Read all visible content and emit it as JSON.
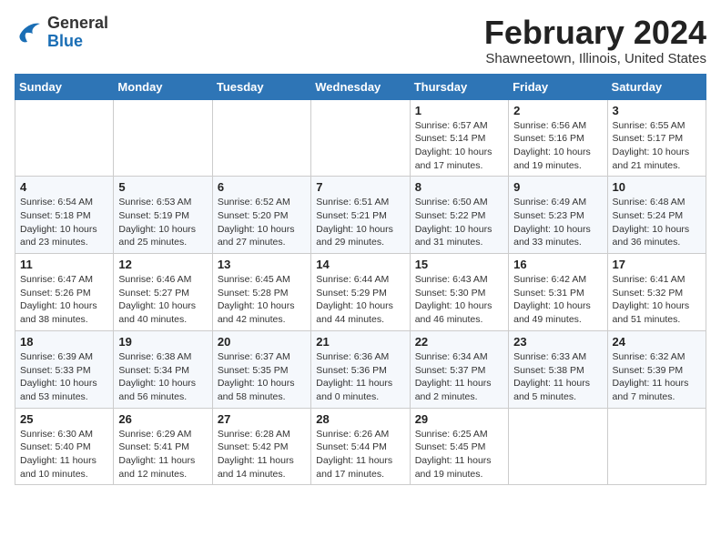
{
  "header": {
    "logo_general": "General",
    "logo_blue": "Blue",
    "month_year": "February 2024",
    "location": "Shawneetown, Illinois, United States"
  },
  "days_of_week": [
    "Sunday",
    "Monday",
    "Tuesday",
    "Wednesday",
    "Thursday",
    "Friday",
    "Saturday"
  ],
  "weeks": [
    [
      {
        "day": "",
        "info": ""
      },
      {
        "day": "",
        "info": ""
      },
      {
        "day": "",
        "info": ""
      },
      {
        "day": "",
        "info": ""
      },
      {
        "day": "1",
        "info": "Sunrise: 6:57 AM\nSunset: 5:14 PM\nDaylight: 10 hours\nand 17 minutes."
      },
      {
        "day": "2",
        "info": "Sunrise: 6:56 AM\nSunset: 5:16 PM\nDaylight: 10 hours\nand 19 minutes."
      },
      {
        "day": "3",
        "info": "Sunrise: 6:55 AM\nSunset: 5:17 PM\nDaylight: 10 hours\nand 21 minutes."
      }
    ],
    [
      {
        "day": "4",
        "info": "Sunrise: 6:54 AM\nSunset: 5:18 PM\nDaylight: 10 hours\nand 23 minutes."
      },
      {
        "day": "5",
        "info": "Sunrise: 6:53 AM\nSunset: 5:19 PM\nDaylight: 10 hours\nand 25 minutes."
      },
      {
        "day": "6",
        "info": "Sunrise: 6:52 AM\nSunset: 5:20 PM\nDaylight: 10 hours\nand 27 minutes."
      },
      {
        "day": "7",
        "info": "Sunrise: 6:51 AM\nSunset: 5:21 PM\nDaylight: 10 hours\nand 29 minutes."
      },
      {
        "day": "8",
        "info": "Sunrise: 6:50 AM\nSunset: 5:22 PM\nDaylight: 10 hours\nand 31 minutes."
      },
      {
        "day": "9",
        "info": "Sunrise: 6:49 AM\nSunset: 5:23 PM\nDaylight: 10 hours\nand 33 minutes."
      },
      {
        "day": "10",
        "info": "Sunrise: 6:48 AM\nSunset: 5:24 PM\nDaylight: 10 hours\nand 36 minutes."
      }
    ],
    [
      {
        "day": "11",
        "info": "Sunrise: 6:47 AM\nSunset: 5:26 PM\nDaylight: 10 hours\nand 38 minutes."
      },
      {
        "day": "12",
        "info": "Sunrise: 6:46 AM\nSunset: 5:27 PM\nDaylight: 10 hours\nand 40 minutes."
      },
      {
        "day": "13",
        "info": "Sunrise: 6:45 AM\nSunset: 5:28 PM\nDaylight: 10 hours\nand 42 minutes."
      },
      {
        "day": "14",
        "info": "Sunrise: 6:44 AM\nSunset: 5:29 PM\nDaylight: 10 hours\nand 44 minutes."
      },
      {
        "day": "15",
        "info": "Sunrise: 6:43 AM\nSunset: 5:30 PM\nDaylight: 10 hours\nand 46 minutes."
      },
      {
        "day": "16",
        "info": "Sunrise: 6:42 AM\nSunset: 5:31 PM\nDaylight: 10 hours\nand 49 minutes."
      },
      {
        "day": "17",
        "info": "Sunrise: 6:41 AM\nSunset: 5:32 PM\nDaylight: 10 hours\nand 51 minutes."
      }
    ],
    [
      {
        "day": "18",
        "info": "Sunrise: 6:39 AM\nSunset: 5:33 PM\nDaylight: 10 hours\nand 53 minutes."
      },
      {
        "day": "19",
        "info": "Sunrise: 6:38 AM\nSunset: 5:34 PM\nDaylight: 10 hours\nand 56 minutes."
      },
      {
        "day": "20",
        "info": "Sunrise: 6:37 AM\nSunset: 5:35 PM\nDaylight: 10 hours\nand 58 minutes."
      },
      {
        "day": "21",
        "info": "Sunrise: 6:36 AM\nSunset: 5:36 PM\nDaylight: 11 hours\nand 0 minutes."
      },
      {
        "day": "22",
        "info": "Sunrise: 6:34 AM\nSunset: 5:37 PM\nDaylight: 11 hours\nand 2 minutes."
      },
      {
        "day": "23",
        "info": "Sunrise: 6:33 AM\nSunset: 5:38 PM\nDaylight: 11 hours\nand 5 minutes."
      },
      {
        "day": "24",
        "info": "Sunrise: 6:32 AM\nSunset: 5:39 PM\nDaylight: 11 hours\nand 7 minutes."
      }
    ],
    [
      {
        "day": "25",
        "info": "Sunrise: 6:30 AM\nSunset: 5:40 PM\nDaylight: 11 hours\nand 10 minutes."
      },
      {
        "day": "26",
        "info": "Sunrise: 6:29 AM\nSunset: 5:41 PM\nDaylight: 11 hours\nand 12 minutes."
      },
      {
        "day": "27",
        "info": "Sunrise: 6:28 AM\nSunset: 5:42 PM\nDaylight: 11 hours\nand 14 minutes."
      },
      {
        "day": "28",
        "info": "Sunrise: 6:26 AM\nSunset: 5:44 PM\nDaylight: 11 hours\nand 17 minutes."
      },
      {
        "day": "29",
        "info": "Sunrise: 6:25 AM\nSunset: 5:45 PM\nDaylight: 11 hours\nand 19 minutes."
      },
      {
        "day": "",
        "info": ""
      },
      {
        "day": "",
        "info": ""
      }
    ]
  ]
}
